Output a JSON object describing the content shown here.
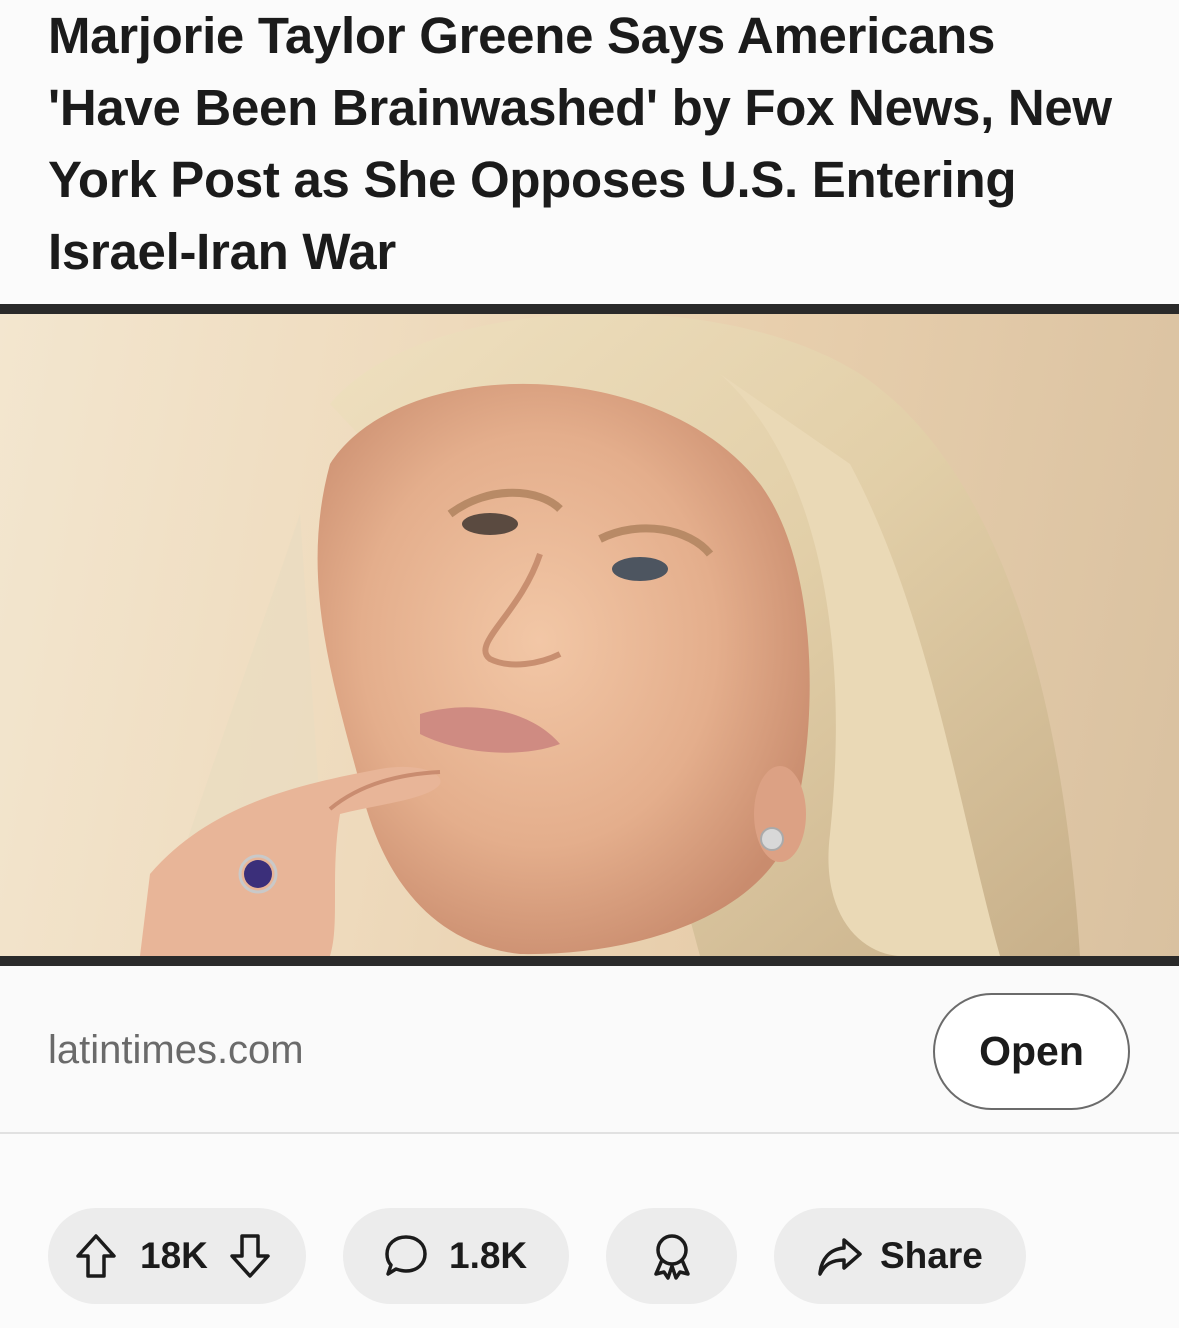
{
  "post": {
    "title": "Marjorie Taylor Greene Says Americans 'Have Been Brainwashed' by Fox News, New York Post as She Opposes U.S. Entering Israel-Iran War",
    "image_alt": "Photo of Marjorie Taylor Greene with finger on chin"
  },
  "link": {
    "domain": "latintimes.com",
    "open_label": "Open"
  },
  "actions": {
    "score": "18K",
    "comments": "1.8K",
    "share_label": "Share",
    "icons": [
      "upvote-icon",
      "downvote-icon",
      "comment-icon",
      "award-icon",
      "share-icon"
    ]
  }
}
